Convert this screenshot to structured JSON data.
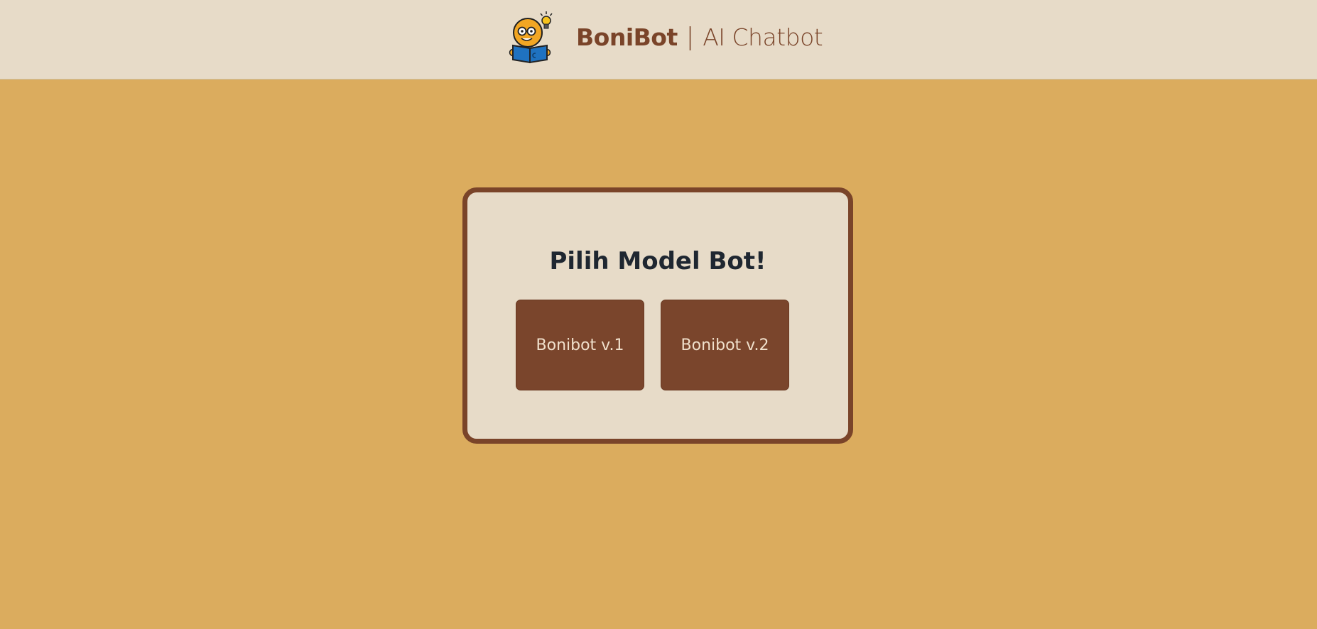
{
  "header": {
    "brand_name": "BoniBot",
    "separator": "|",
    "subtitle": "AI Chatbot",
    "logo_icon": "boni-reading-book-logo"
  },
  "selector": {
    "title": "Pilih Model Bot!",
    "options": [
      {
        "label": "Bonibot v.1"
      },
      {
        "label": "Bonibot v.2"
      }
    ]
  },
  "colors": {
    "page_background": "#dbac5e",
    "header_background": "#e7dbc8",
    "brand": "#7a4429",
    "card_background": "#e7dbc8",
    "button_background": "#7a452c",
    "button_text": "#f0e0cc",
    "title_text": "#1f2731"
  }
}
